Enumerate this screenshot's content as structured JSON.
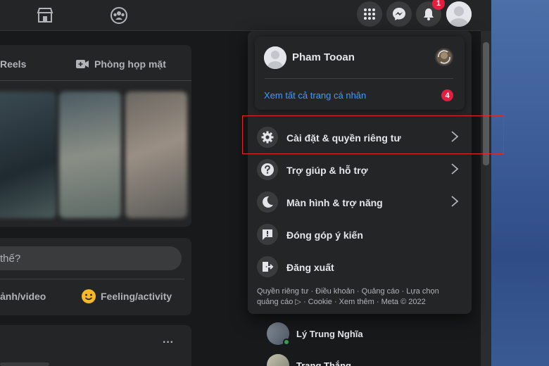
{
  "topbar": {
    "marketplace_icon": "marketplace-icon",
    "groups_icon": "groups-icon",
    "menu_icon": "grid-menu-icon",
    "messenger_icon": "messenger-icon",
    "notifications_icon": "bell-icon",
    "notifications_count": "1"
  },
  "feed": {
    "tab_reels": "Reels",
    "tab_rooms": "Phòng họp mặt",
    "composer_placeholder": "thế?",
    "action_photo": "ảnh/video",
    "action_feeling": "Feeling/activity",
    "post_menu": "···"
  },
  "account_menu": {
    "profile_name": "Pham Tooan",
    "see_all_profiles": "Xem tất cả trang cá nhân",
    "see_all_badge": "4",
    "items": [
      {
        "label": "Cài đặt & quyền riêng tư",
        "icon": "gear-icon",
        "has_chevron": true
      },
      {
        "label": "Trợ giúp & hỗ trợ",
        "icon": "help-icon",
        "has_chevron": true
      },
      {
        "label": "Màn hình & trợ năng",
        "icon": "moon-icon",
        "has_chevron": true
      },
      {
        "label": "Đóng góp ý kiến",
        "icon": "feedback-icon",
        "has_chevron": false
      },
      {
        "label": "Đăng xuất",
        "icon": "logout-icon",
        "has_chevron": false
      }
    ],
    "footer_line1": "Quyền riêng tư · Điều khoản · Quảng cáo · Lựa chọn",
    "footer_line2": "quảng cáo ▷ · Cookie · Xem thêm · Meta © 2022"
  },
  "contacts": [
    {
      "name": "Lý Trung Nghĩa",
      "online": true
    },
    {
      "name": "Trang Thắng",
      "online": false
    }
  ],
  "colors": {
    "background": "#18191a",
    "surface": "#242526",
    "link": "#4599ff",
    "badge": "#e41e3f",
    "highlight": "#e0282e"
  }
}
